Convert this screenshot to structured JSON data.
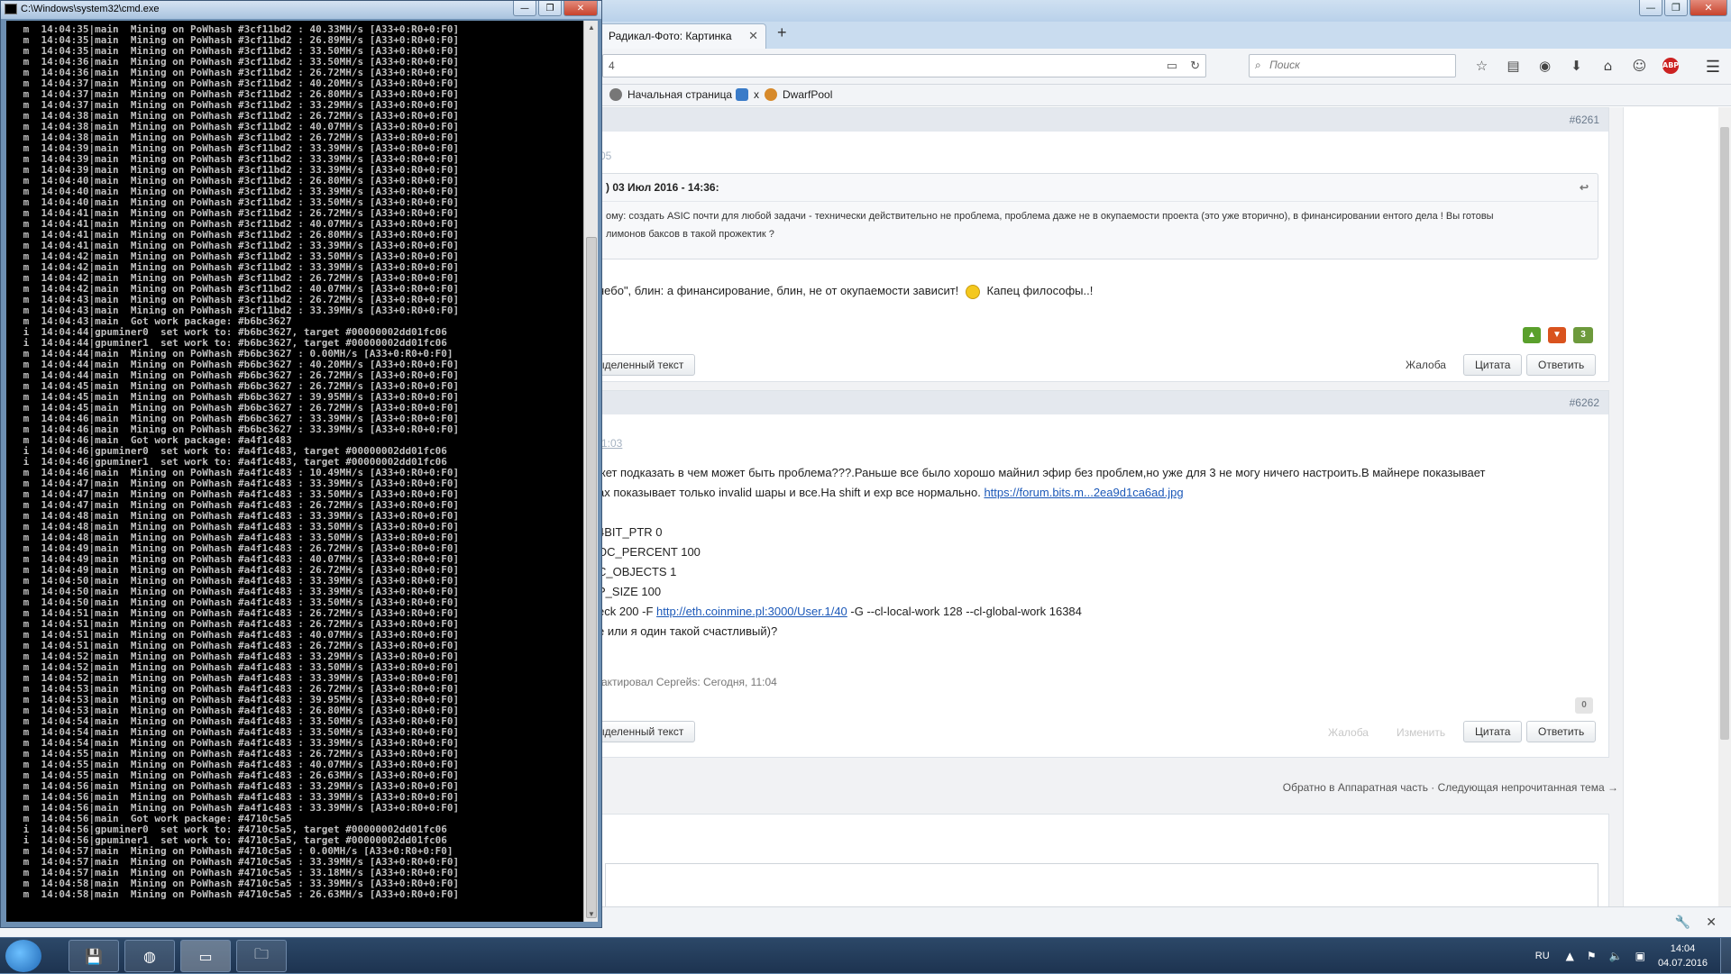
{
  "console": {
    "title": "C:\\Windows\\system32\\cmd.exe",
    "lines": [
      " m  14:04:35|main  Mining on PoWhash #3cf11bd2 : 40.33MH/s [A33+0:R0+0:F0]",
      " m  14:04:35|main  Mining on PoWhash #3cf11bd2 : 26.89MH/s [A33+0:R0+0:F0]",
      " m  14:04:35|main  Mining on PoWhash #3cf11bd2 : 33.50MH/s [A33+0:R0+0:F0]",
      " m  14:04:36|main  Mining on PoWhash #3cf11bd2 : 33.50MH/s [A33+0:R0+0:F0]",
      " m  14:04:36|main  Mining on PoWhash #3cf11bd2 : 26.72MH/s [A33+0:R0+0:F0]",
      " m  14:04:37|main  Mining on PoWhash #3cf11bd2 : 40.20MH/s [A33+0:R0+0:F0]",
      " m  14:04:37|main  Mining on PoWhash #3cf11bd2 : 26.80MH/s [A33+0:R0+0:F0]",
      " m  14:04:37|main  Mining on PoWhash #3cf11bd2 : 33.29MH/s [A33+0:R0+0:F0]",
      " m  14:04:38|main  Mining on PoWhash #3cf11bd2 : 26.72MH/s [A33+0:R0+0:F0]",
      " m  14:04:38|main  Mining on PoWhash #3cf11bd2 : 40.07MH/s [A33+0:R0+0:F0]",
      " m  14:04:38|main  Mining on PoWhash #3cf11bd2 : 26.72MH/s [A33+0:R0+0:F0]",
      " m  14:04:39|main  Mining on PoWhash #3cf11bd2 : 33.39MH/s [A33+0:R0+0:F0]",
      " m  14:04:39|main  Mining on PoWhash #3cf11bd2 : 33.39MH/s [A33+0:R0+0:F0]",
      " m  14:04:39|main  Mining on PoWhash #3cf11bd2 : 33.39MH/s [A33+0:R0+0:F0]",
      " m  14:04:40|main  Mining on PoWhash #3cf11bd2 : 26.80MH/s [A33+0:R0+0:F0]",
      " m  14:04:40|main  Mining on PoWhash #3cf11bd2 : 33.39MH/s [A33+0:R0+0:F0]",
      " m  14:04:40|main  Mining on PoWhash #3cf11bd2 : 33.50MH/s [A33+0:R0+0:F0]",
      " m  14:04:41|main  Mining on PoWhash #3cf11bd2 : 26.72MH/s [A33+0:R0+0:F0]",
      " m  14:04:41|main  Mining on PoWhash #3cf11bd2 : 40.07MH/s [A33+0:R0+0:F0]",
      " m  14:04:41|main  Mining on PoWhash #3cf11bd2 : 26.80MH/s [A33+0:R0+0:F0]",
      " m  14:04:41|main  Mining on PoWhash #3cf11bd2 : 33.39MH/s [A33+0:R0+0:F0]",
      " m  14:04:42|main  Mining on PoWhash #3cf11bd2 : 33.50MH/s [A33+0:R0+0:F0]",
      " m  14:04:42|main  Mining on PoWhash #3cf11bd2 : 33.39MH/s [A33+0:R0+0:F0]",
      " m  14:04:42|main  Mining on PoWhash #3cf11bd2 : 26.72MH/s [A33+0:R0+0:F0]",
      " m  14:04:42|main  Mining on PoWhash #3cf11bd2 : 40.07MH/s [A33+0:R0+0:F0]",
      " m  14:04:43|main  Mining on PoWhash #3cf11bd2 : 26.72MH/s [A33+0:R0+0:F0]",
      " m  14:04:43|main  Mining on PoWhash #3cf11bd2 : 33.39MH/s [A33+0:R0+0:F0]",
      " m  14:04:43|main  Got work package: #b6bc3627",
      " i  14:04:44|gpuminer0  set work to: #b6bc3627, target #00000002dd01fc06",
      " i  14:04:44|gpuminer1  set work to: #b6bc3627, target #00000002dd01fc06",
      " m  14:04:44|main  Mining on PoWhash #b6bc3627 : 0.00MH/s [A33+0:R0+0:F0]",
      " m  14:04:44|main  Mining on PoWhash #b6bc3627 : 40.20MH/s [A33+0:R0+0:F0]",
      " m  14:04:44|main  Mining on PoWhash #b6bc3627 : 26.72MH/s [A33+0:R0+0:F0]",
      " m  14:04:45|main  Mining on PoWhash #b6bc3627 : 26.72MH/s [A33+0:R0+0:F0]",
      " m  14:04:45|main  Mining on PoWhash #b6bc3627 : 39.95MH/s [A33+0:R0+0:F0]",
      " m  14:04:45|main  Mining on PoWhash #b6bc3627 : 26.72MH/s [A33+0:R0+0:F0]",
      " m  14:04:46|main  Mining on PoWhash #b6bc3627 : 33.39MH/s [A33+0:R0+0:F0]",
      " m  14:04:46|main  Mining on PoWhash #b6bc3627 : 33.39MH/s [A33+0:R0+0:F0]",
      " m  14:04:46|main  Got work package: #a4f1c483",
      " i  14:04:46|gpuminer0  set work to: #a4f1c483, target #00000002dd01fc06",
      " i  14:04:46|gpuminer1  set work to: #a4f1c483, target #00000002dd01fc06",
      " m  14:04:46|main  Mining on PoWhash #a4f1c483 : 10.49MH/s [A33+0:R0+0:F0]",
      " m  14:04:47|main  Mining on PoWhash #a4f1c483 : 33.39MH/s [A33+0:R0+0:F0]",
      " m  14:04:47|main  Mining on PoWhash #a4f1c483 : 33.50MH/s [A33+0:R0+0:F0]",
      " m  14:04:47|main  Mining on PoWhash #a4f1c483 : 26.72MH/s [A33+0:R0+0:F0]",
      " m  14:04:48|main  Mining on PoWhash #a4f1c483 : 33.39MH/s [A33+0:R0+0:F0]",
      " m  14:04:48|main  Mining on PoWhash #a4f1c483 : 33.50MH/s [A33+0:R0+0:F0]",
      " m  14:04:48|main  Mining on PoWhash #a4f1c483 : 33.50MH/s [A33+0:R0+0:F0]",
      " m  14:04:49|main  Mining on PoWhash #a4f1c483 : 26.72MH/s [A33+0:R0+0:F0]",
      " m  14:04:49|main  Mining on PoWhash #a4f1c483 : 40.07MH/s [A33+0:R0+0:F0]",
      " m  14:04:49|main  Mining on PoWhash #a4f1c483 : 26.72MH/s [A33+0:R0+0:F0]",
      " m  14:04:50|main  Mining on PoWhash #a4f1c483 : 33.39MH/s [A33+0:R0+0:F0]",
      " m  14:04:50|main  Mining on PoWhash #a4f1c483 : 33.39MH/s [A33+0:R0+0:F0]",
      " m  14:04:50|main  Mining on PoWhash #a4f1c483 : 33.50MH/s [A33+0:R0+0:F0]",
      " m  14:04:51|main  Mining on PoWhash #a4f1c483 : 26.72MH/s [A33+0:R0+0:F0]",
      " m  14:04:51|main  Mining on PoWhash #a4f1c483 : 26.72MH/s [A33+0:R0+0:F0]",
      " m  14:04:51|main  Mining on PoWhash #a4f1c483 : 40.07MH/s [A33+0:R0+0:F0]",
      " m  14:04:51|main  Mining on PoWhash #a4f1c483 : 26.72MH/s [A33+0:R0+0:F0]",
      " m  14:04:52|main  Mining on PoWhash #a4f1c483 : 33.29MH/s [A33+0:R0+0:F0]",
      " m  14:04:52|main  Mining on PoWhash #a4f1c483 : 33.50MH/s [A33+0:R0+0:F0]",
      " m  14:04:52|main  Mining on PoWhash #a4f1c483 : 33.39MH/s [A33+0:R0+0:F0]",
      " m  14:04:53|main  Mining on PoWhash #a4f1c483 : 26.72MH/s [A33+0:R0+0:F0]",
      " m  14:04:53|main  Mining on PoWhash #a4f1c483 : 39.95MH/s [A33+0:R0+0:F0]",
      " m  14:04:53|main  Mining on PoWhash #a4f1c483 : 26.80MH/s [A33+0:R0+0:F0]",
      " m  14:04:54|main  Mining on PoWhash #a4f1c483 : 33.50MH/s [A33+0:R0+0:F0]",
      " m  14:04:54|main  Mining on PoWhash #a4f1c483 : 33.50MH/s [A33+0:R0+0:F0]",
      " m  14:04:54|main  Mining on PoWhash #a4f1c483 : 33.39MH/s [A33+0:R0+0:F0]",
      " m  14:04:55|main  Mining on PoWhash #a4f1c483 : 26.72MH/s [A33+0:R0+0:F0]",
      " m  14:04:55|main  Mining on PoWhash #a4f1c483 : 40.07MH/s [A33+0:R0+0:F0]",
      " m  14:04:55|main  Mining on PoWhash #a4f1c483 : 26.63MH/s [A33+0:R0+0:F0]",
      " m  14:04:56|main  Mining on PoWhash #a4f1c483 : 33.29MH/s [A33+0:R0+0:F0]",
      " m  14:04:56|main  Mining on PoWhash #a4f1c483 : 33.39MH/s [A33+0:R0+0:F0]",
      " m  14:04:56|main  Mining on PoWhash #a4f1c483 : 33.39MH/s [A33+0:R0+0:F0]",
      " m  14:04:56|main  Got work package: #4710c5a5",
      " i  14:04:56|gpuminer0  set work to: #4710c5a5, target #00000002dd01fc06",
      " i  14:04:56|gpuminer1  set work to: #4710c5a5, target #00000002dd01fc06",
      " m  14:04:57|main  Mining on PoWhash #4710c5a5 : 0.00MH/s [A33+0:R0+0:F0]",
      " m  14:04:57|main  Mining on PoWhash #4710c5a5 : 33.39MH/s [A33+0:R0+0:F0]",
      " m  14:04:57|main  Mining on PoWhash #4710c5a5 : 33.18MH/s [A33+0:R0+0:F0]",
      " m  14:04:58|main  Mining on PoWhash #4710c5a5 : 33.39MH/s [A33+0:R0+0:F0]",
      " m  14:04:58|main  Mining on PoWhash #4710c5a5 : 26.63MH/s [A33+0:R0+0:F0]"
    ]
  },
  "browser": {
    "tab_title": "Радикал-Фото: Картинка",
    "url_fragment": "4",
    "search_placeholder": "Поиск",
    "bookmarks": [
      "Начальная страница",
      "x",
      "DwarfPool"
    ]
  },
  "forum": {
    "post1": {
      "number": "#6261",
      "date_fragment": "05",
      "quote_header": ") 03 Июл 2016 - 14:36:",
      "quote_line1": "ому: создать ASIC почти для любой задачи - технически действительно не проблема, проблема даже не в окупаемости проекта (это уже вторично), в финансировании ентого дела !  Вы готовы",
      "quote_line2": "лимонов баксов в такой прожектик ?",
      "text_before_smiley": "небо\", блин: а финансирование, блин, не от окупаемости зависит!",
      "text_after_smiley": "Капец философы..!",
      "vote_count": "3",
      "quote_selected": "ыделенный текст",
      "complain": "Жалоба",
      "quote_btn": "Цитата",
      "reply_btn": "Ответить"
    },
    "post2": {
      "number": "#6262",
      "date_fragment": "1:03",
      "line1": "жет подказать в чем может быть проблема???.Раньше все было хорошо майнил эфир без проблем,но уже для 3 не могу ничего настроить.В майнере показывает",
      "line2_text": "ах показывает только invalid шары и все.На shift и exp  все нормально.",
      "line2_link": "https://forum.bits.m...2ea9d1ca6ad.jpg",
      "cfg1": "4BIT_PTR 0",
      "cfg2": "OC_PERCENT 100",
      "cfg3": "C_OBJECTS 1",
      "cfg4": "P_SIZE 100",
      "cmd_prefix": "eck 200 -F",
      "cmd_link": "http://eth.coinmine.pl:3000/User.1/40",
      "cmd_suffix": "-G --cl-local-work 128 --cl-global-work 16384",
      "question": "е или я один такой счастливый)?",
      "edited": "актировал Сергейs: Сегодня, 11:04",
      "vote_count": "0",
      "quote_selected": "ыделенный текст",
      "complain": "Жалоба",
      "edit": "Изменить",
      "quote_btn": "Цитата",
      "reply_btn": "Ответить"
    },
    "nav_footer": "Обратно в Аппаратная часть · Следующая непрочитанная тема →"
  },
  "taskbar": {
    "lang": "RU",
    "time": "14:04",
    "date": "04.07.2016"
  },
  "colors": {
    "vote_up": "#5aa02c",
    "vote_down": "#d9531e",
    "vote_count": "#6d9a3c",
    "link": "#1b58b8"
  }
}
